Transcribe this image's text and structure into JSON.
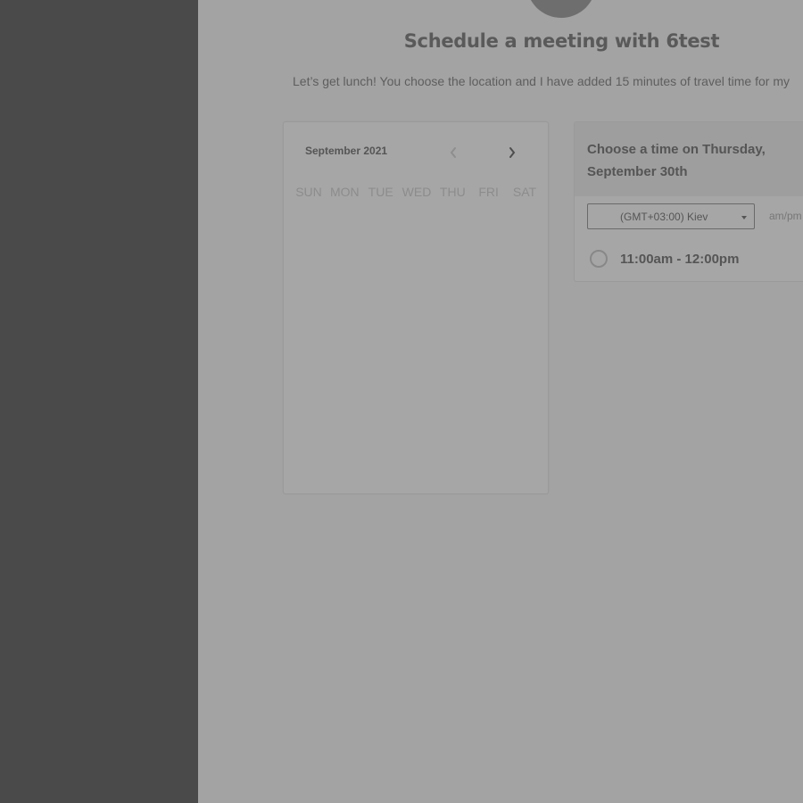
{
  "page": {
    "title": "Schedule a meeting with 6test",
    "subtitle": "Let’s get lunch! You choose the location and I have added 15 minutes of travel time for my"
  },
  "calendar": {
    "month_label": "September 2021",
    "prev_icon": "chevron-left-icon",
    "next_icon": "chevron-right-icon",
    "weekdays": [
      "SUN",
      "MON",
      "TUE",
      "WED",
      "THU",
      "FRI",
      "SAT"
    ]
  },
  "time_panel": {
    "heading": "Choose a time on Thursday, September 30th",
    "timezone": "(GMT+03:00) Kiev",
    "format_label": "am/pm",
    "slots": [
      {
        "label": "11:00am - 12:00pm"
      }
    ]
  },
  "colors": {
    "sidebar": "#4a4a4a",
    "background": "#a3a3a3",
    "text_primary": "#555555"
  }
}
